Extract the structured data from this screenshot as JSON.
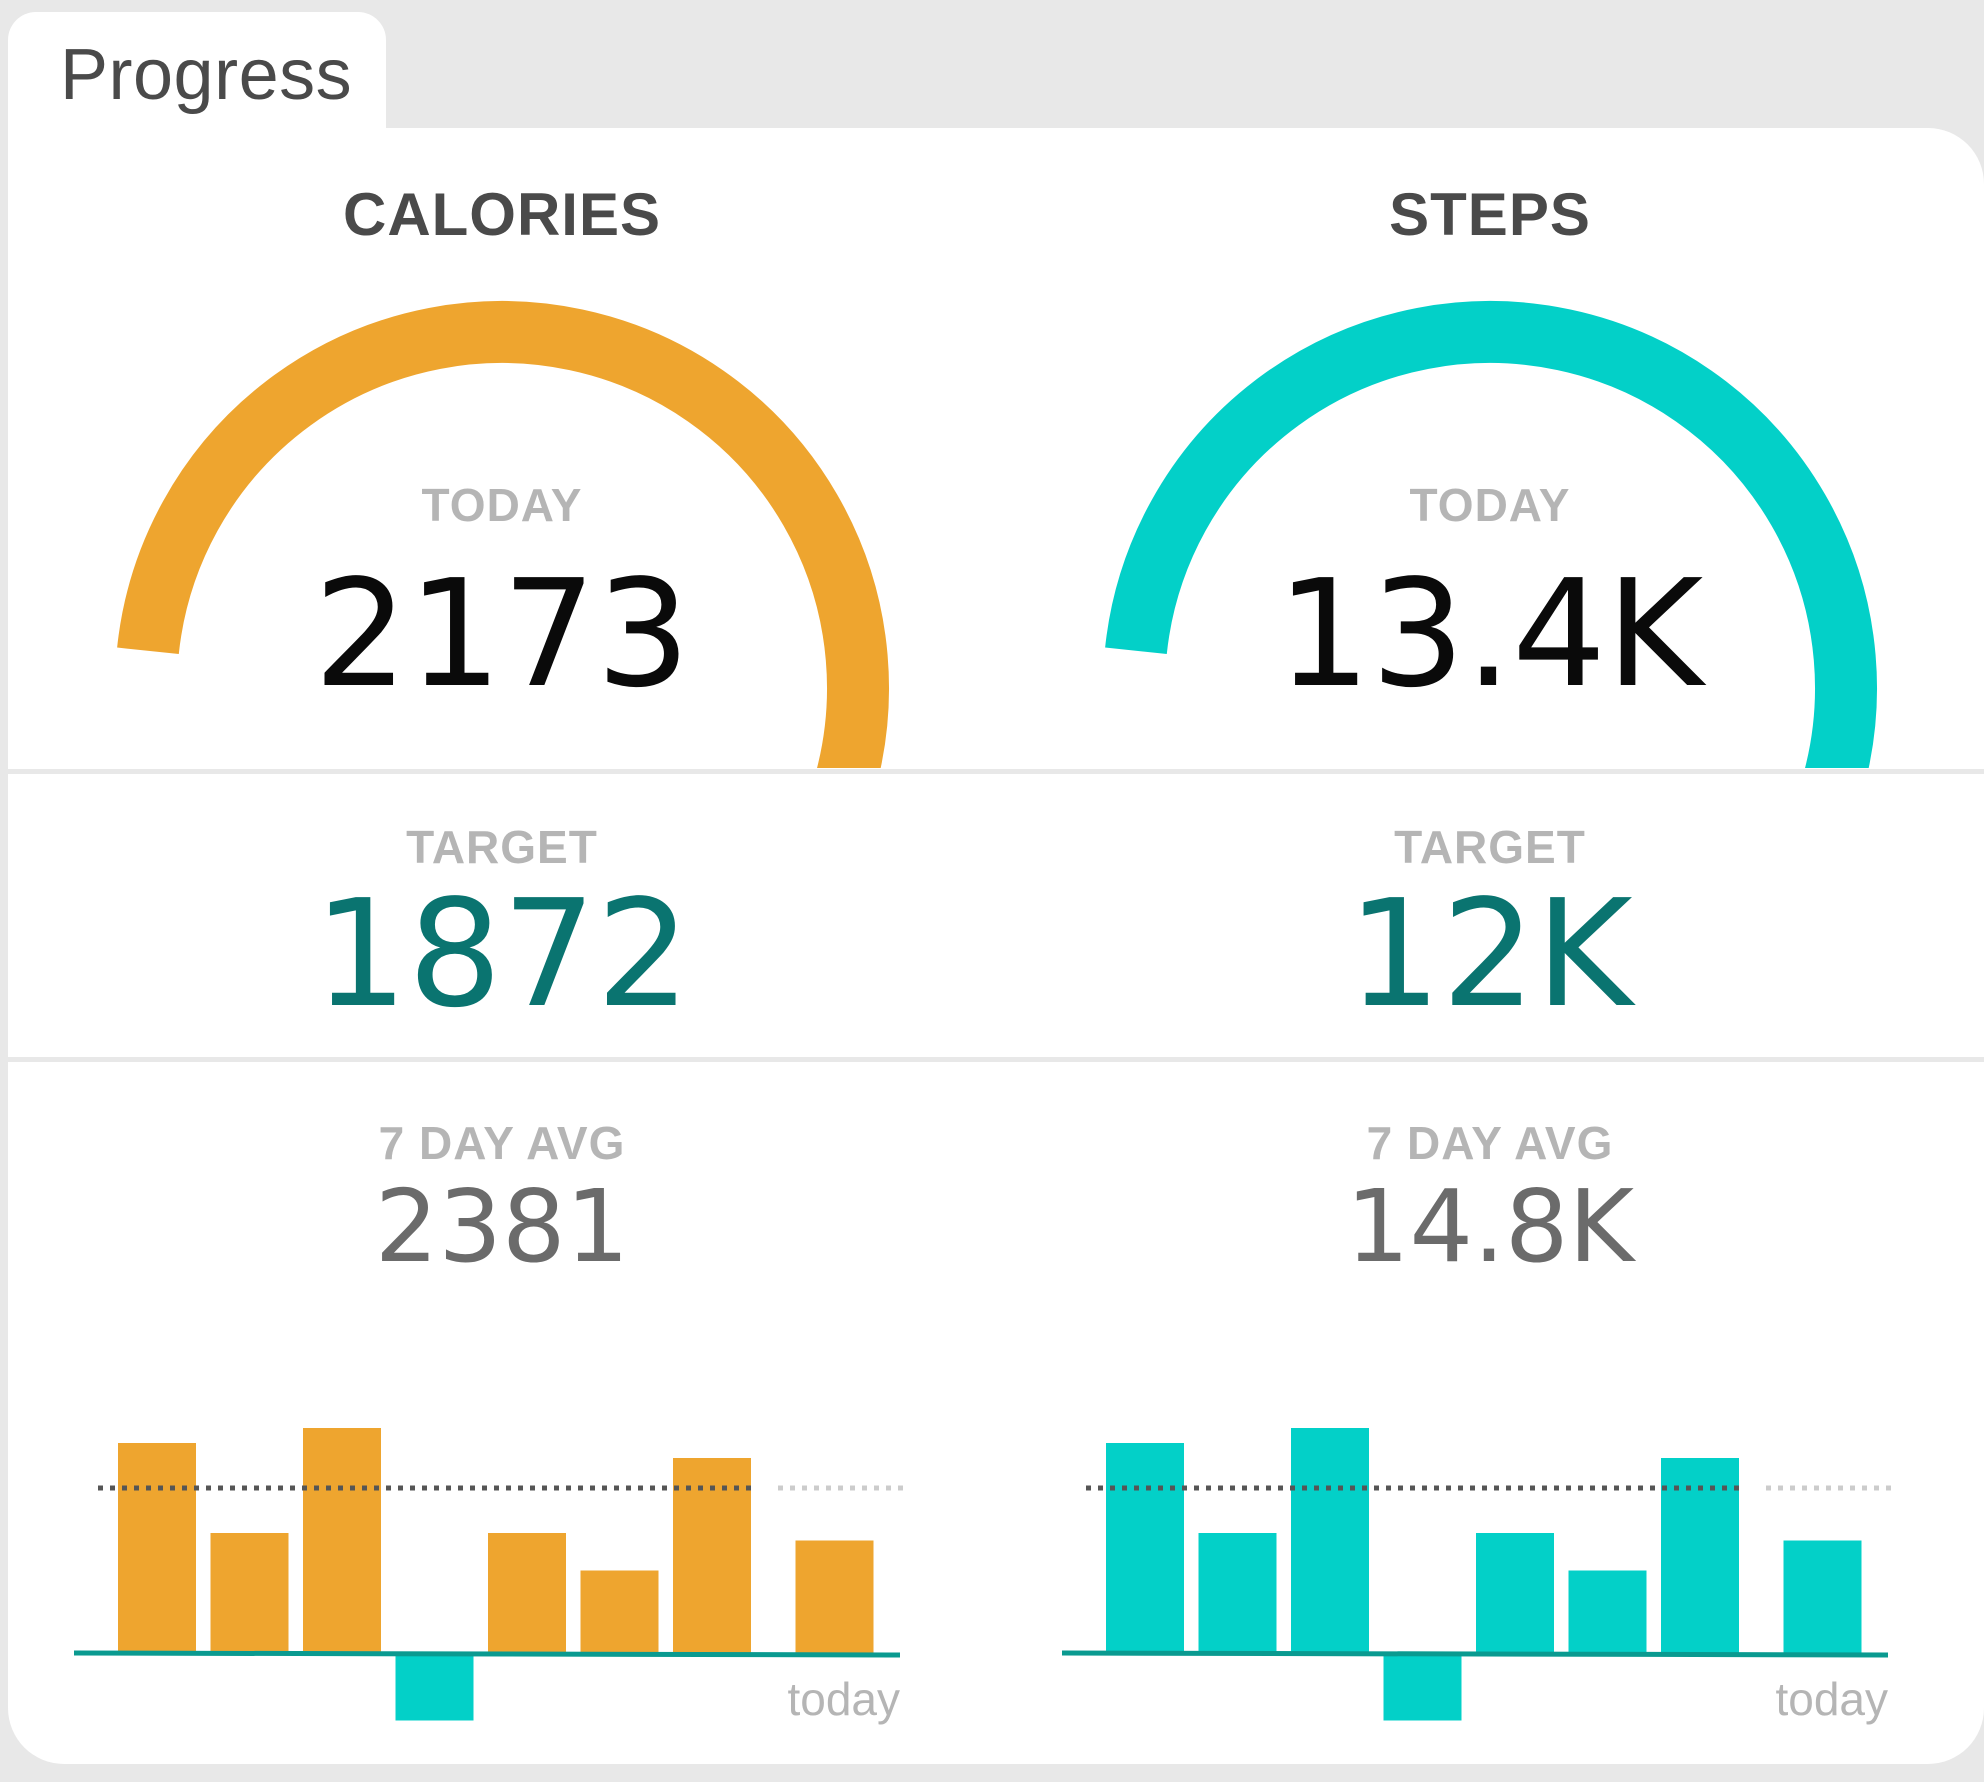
{
  "tab": {
    "label": "Progress"
  },
  "colors": {
    "calories": "#eea52f",
    "steps": "#03d0c8",
    "target": "#0a7470",
    "negative": "#03d0c8",
    "baseline": "#0a9a90"
  },
  "labels": {
    "today": "TODAY",
    "target": "TARGET",
    "avg": "7 DAY AVG",
    "today_axis": "today"
  },
  "metrics": [
    {
      "key": "calories",
      "title": "CALORIES",
      "today_value": "2173",
      "target_value": "1872",
      "avg_value": "2381",
      "gauge_fraction": 1.0,
      "chart_data": {
        "type": "bar",
        "values": [
          2.8,
          1.6,
          3.4,
          -0.9,
          1.6,
          1.1,
          2.6,
          1.5
        ],
        "target_line": 2.2,
        "ylim": [
          -1,
          3.6
        ]
      }
    },
    {
      "key": "steps",
      "title": "STEPS",
      "today_value": "13.4K",
      "target_value": "12K",
      "avg_value": "14.8K",
      "gauge_fraction": 1.0,
      "chart_data": {
        "type": "bar",
        "values": [
          2.8,
          1.6,
          3.4,
          -0.9,
          1.6,
          1.1,
          2.6,
          1.5
        ],
        "target_line": 2.2,
        "ylim": [
          -1,
          3.6
        ]
      }
    }
  ]
}
